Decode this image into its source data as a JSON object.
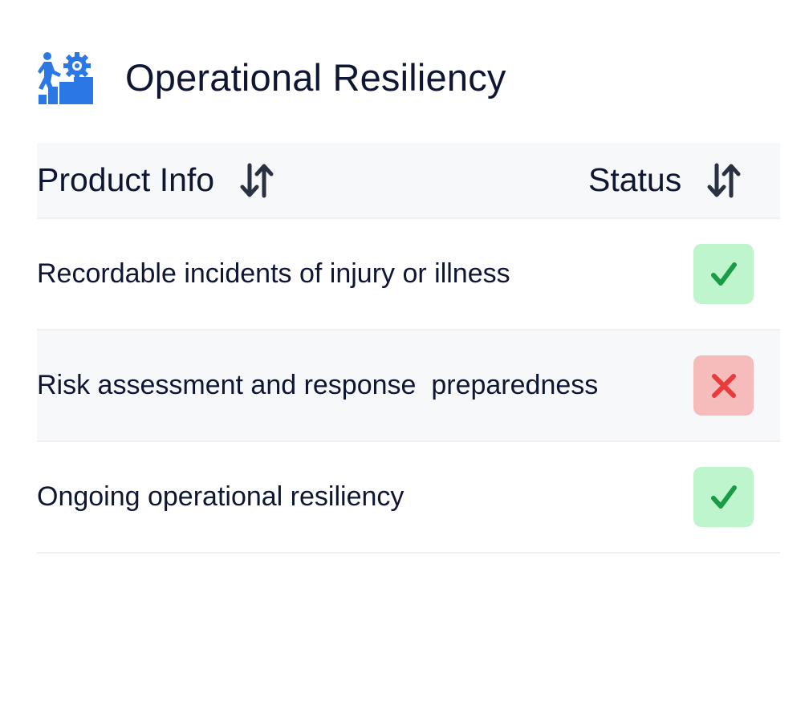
{
  "header": {
    "title": "Operational Resiliency",
    "icon": "progress-climb-gear-icon",
    "icon_color": "#2b78e4"
  },
  "table": {
    "columns": [
      {
        "label": "Product Info",
        "sort_icon": "sort-arrows-icon"
      },
      {
        "label": "Status",
        "sort_icon": "sort-arrows-icon"
      }
    ],
    "rows": [
      {
        "label": "Recordable incidents of injury or illness",
        "status": "pass"
      },
      {
        "label": "Risk assessment and response  preparedness",
        "status": "fail"
      },
      {
        "label": "Ongoing operational resiliency",
        "status": "pass"
      }
    ]
  },
  "colors": {
    "text": "#0f1633",
    "header_bg": "#f7f8fa",
    "pass_bg": "#bff5cc",
    "pass_fg": "#1a9b45",
    "fail_bg": "#f6bbbb",
    "fail_fg": "#e83b3b"
  }
}
